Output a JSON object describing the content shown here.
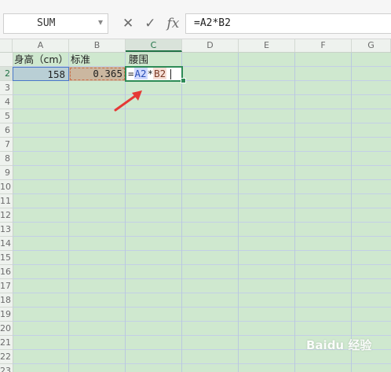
{
  "formula_bar": {
    "name_box": "SUM",
    "cancel_icon": "✕",
    "confirm_icon": "✓",
    "fx_icon": "fx",
    "formula": "=A2*B2"
  },
  "columns": [
    "A",
    "B",
    "C",
    "D",
    "E",
    "F",
    "G"
  ],
  "rows": [
    "2",
    "3",
    "4",
    "5",
    "6",
    "7",
    "8",
    "9",
    "10",
    "11",
    "12",
    "13",
    "14",
    "15",
    "16",
    "17",
    "18",
    "19",
    "20",
    "21",
    "22",
    "23"
  ],
  "cells": {
    "A1": "身高（cm）",
    "B1": "标准",
    "C1": "腰围",
    "A2": "158",
    "B2": "0.365",
    "C2_formula": {
      "eq": "=",
      "ref1": "A2",
      "op": "*",
      "ref2": "B2"
    }
  },
  "watermark": "Baidu 经验",
  "colors": {
    "grid_bg": "#cfe8cf",
    "accent": "#217346",
    "arrow": "#e53935"
  }
}
